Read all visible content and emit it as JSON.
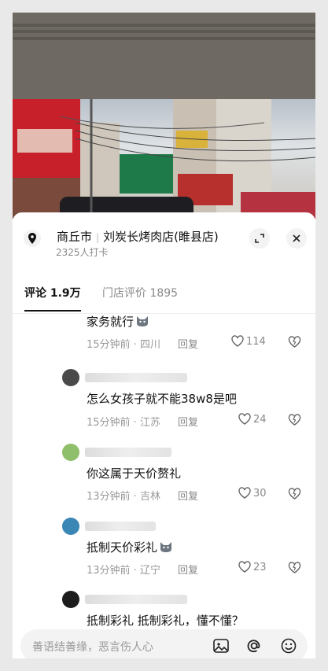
{
  "store": {
    "city": "商丘市",
    "name": "刘炭长烤肉店(睢县店)",
    "checkins": "2325人打卡"
  },
  "tabs": [
    {
      "label": "评论 1.9万"
    },
    {
      "label": "门店评价 1895"
    }
  ],
  "comments": [
    {
      "text": "家务就行",
      "time_loc": "15分钟前 · 四川",
      "reply": "回复",
      "likes": "114"
    },
    {
      "text": "怎么女孩子就不能38w8是吧",
      "time_loc": "15分钟前 · 江苏",
      "reply": "回复",
      "likes": "24"
    },
    {
      "text": "你这属于天价赘礼",
      "time_loc": "13分钟前 · 吉林",
      "reply": "回复",
      "likes": "30"
    },
    {
      "text": "抵制天价彩礼",
      "time_loc": "13分钟前 · 辽宁",
      "reply": "回复",
      "likes": "23"
    },
    {
      "text": "抵制彩礼 抵制彩礼，懂不懂？",
      "time_loc": "",
      "reply": "",
      "likes": ""
    }
  ],
  "input": {
    "placeholder": "善语结善缘，恶言伤人心"
  },
  "colors": {
    "text_primary": "#111111",
    "text_secondary": "#999999",
    "sign_red": "#c8202a",
    "sign_green": "#1e7a48"
  }
}
